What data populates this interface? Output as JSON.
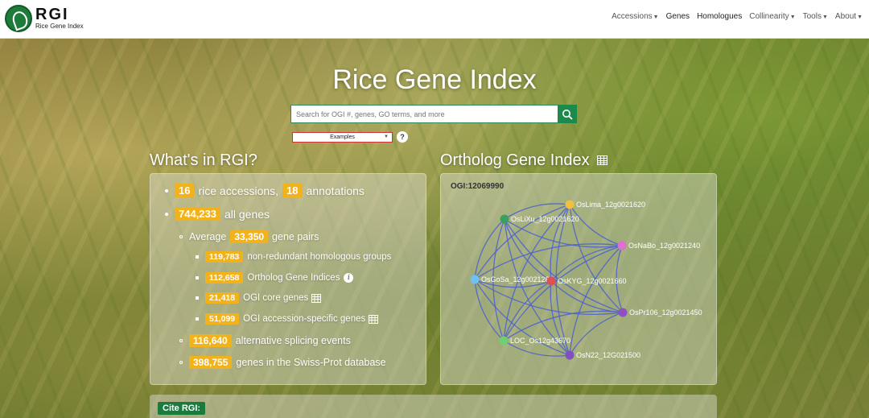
{
  "brand": {
    "title": "RGI",
    "subtitle": "Rice Gene Index"
  },
  "nav": {
    "accessions": "Accessions",
    "genes": "Genes",
    "homologues": "Homologues",
    "collinearity": "Collinearity",
    "tools": "Tools",
    "about": "About"
  },
  "hero": {
    "title": "Rice Gene Index"
  },
  "search": {
    "placeholder": "Search for OGI #, genes, GO terms, and more",
    "examples_label": "Examples",
    "help": "?"
  },
  "stats": {
    "title": "What's in RGI?",
    "accessions_count": "16",
    "accessions_label": "rice accessions,",
    "annotations_count": "18",
    "annotations_label": "annotations",
    "genes_count": "744,233",
    "genes_label": "all genes",
    "average_label": "Average",
    "pairs_count": "33,350",
    "pairs_label": "gene pairs",
    "groups_count": "119,783",
    "groups_label": "non-redundant homologous groups",
    "ogi_count": "112,658",
    "ogi_label": "Ortholog Gene Indices",
    "core_count": "21,418",
    "core_label": "OGI core genes",
    "specific_count": "51,099",
    "specific_label": "OGI accession-specific genes",
    "splicing_count": "116,640",
    "splicing_label": "alternative splicing events",
    "swissprot_count": "398,755",
    "swissprot_label": "genes in the Swiss-Prot database"
  },
  "ogi": {
    "title": "Ortholog Gene Index",
    "id": "OGI:12069990",
    "nodes": [
      {
        "label": "OsLima_12g0021620",
        "color": "#f0c040"
      },
      {
        "label": "OsLiXu_12g0021620",
        "color": "#3aa060"
      },
      {
        "label": "OsNaBo_12g0021240",
        "color": "#e070d0"
      },
      {
        "label": "OsGoSa_12g0021280",
        "color": "#70c0f0"
      },
      {
        "label": "OsKYG_12g0021660",
        "color": "#e05050"
      },
      {
        "label": "OsPr106_12g0021450",
        "color": "#9050c0"
      },
      {
        "label": "LOC_Os12g43670",
        "color": "#70d070"
      },
      {
        "label": "OsN22_12G021500",
        "color": "#8050c0"
      }
    ],
    "edge_color": "#4a5fd0"
  },
  "cite": {
    "label": "Cite RGI:"
  }
}
